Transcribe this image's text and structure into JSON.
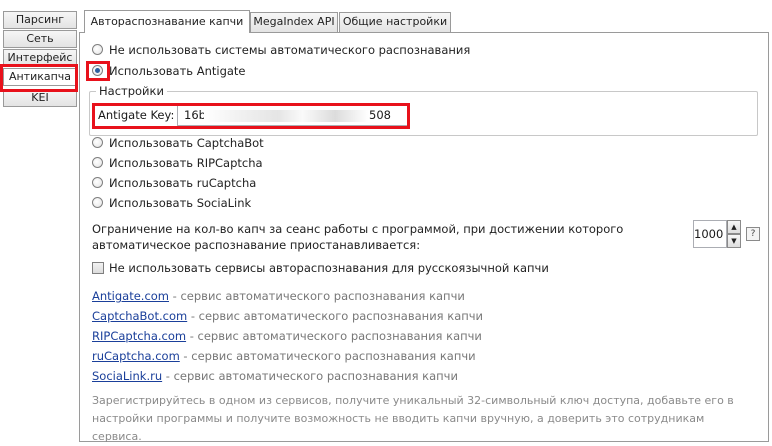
{
  "sidebar": {
    "items": [
      {
        "label": "Парсинг"
      },
      {
        "label": "Сеть"
      },
      {
        "label": "Интерфейс"
      },
      {
        "label": "Антикапча"
      },
      {
        "label": "KEI"
      }
    ],
    "selected": "Антикапча"
  },
  "tabs": [
    {
      "label": "Автораспознавание капчи",
      "active": true
    },
    {
      "label": "MegaIndex API",
      "active": false
    },
    {
      "label": "Общие настройки",
      "active": false
    }
  ],
  "options": {
    "none": "Не использовать системы автоматического распознавания",
    "antigate": "Использовать Antigate",
    "captchabot": "Использовать CaptchaBot",
    "ripcaptcha": "Использовать RIPCaptcha",
    "rucaptcha": "Использовать ruCaptcha",
    "sociallink": "Использовать SociaLink"
  },
  "settings": {
    "group_title": "Настройки",
    "key_label": "Antigate Key:",
    "key_prefix": "16b",
    "key_suffix": "508"
  },
  "limit": {
    "text": "Ограничение на кол-во капч за сеанс работы с программой, при достижении которого автоматическое распознавание приостанавливается:",
    "value": "1000",
    "help": "?"
  },
  "russian_captcha": {
    "label": "Не использовать сервисы автораспознавания для русскоязычной капчи",
    "checked": false
  },
  "links": [
    {
      "name": "Antigate.com",
      "desc": " - сервис автоматического распознавания капчи"
    },
    {
      "name": "CaptchaBot.com",
      "desc": " - сервис автоматического распознавания капчи"
    },
    {
      "name": "RIPCaptcha.com",
      "desc": " - сервис автоматического распознавания капчи"
    },
    {
      "name": "ruCaptcha.com",
      "desc": " - сервис автоматического распознавания капчи"
    },
    {
      "name": "SociaLink.ru",
      "desc": " - сервис автоматического распознавания капчи"
    }
  ],
  "note": "Зарегистрируйтесь в одном из сервисов, получите уникальный 32-символьный ключ доступа, добавьте его в настройки программы и получите возможность не вводить капчи вручную, а доверить это сотрудникам сервиса.",
  "colors": {
    "highlight": "#e8111b",
    "link": "#1a3f9a",
    "radio_dot": "#2c5f9e"
  }
}
